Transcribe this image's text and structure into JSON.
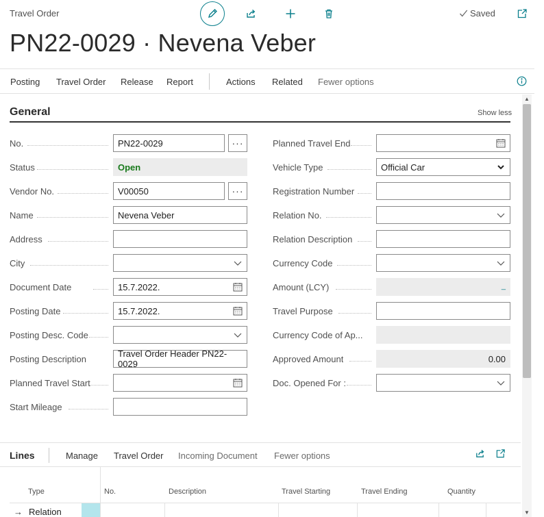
{
  "header": {
    "page_kind": "Travel Order",
    "title": "PN22-0029 · Nevena Veber",
    "saved": "Saved",
    "icons": [
      "edit-icon",
      "share-icon",
      "plus-icon",
      "trash-icon",
      "check-icon",
      "popout-icon"
    ]
  },
  "actions": {
    "items": [
      "Posting",
      "Travel Order",
      "Release",
      "Report",
      "Actions",
      "Related",
      "Fewer options"
    ]
  },
  "general": {
    "title": "General",
    "show_less": "Show less",
    "left": {
      "no": {
        "label": "No.",
        "value": "PN22-0029"
      },
      "status": {
        "label": "Status",
        "value": "Open"
      },
      "vendor_no": {
        "label": "Vendor No.",
        "value": "V00050"
      },
      "name": {
        "label": "Name",
        "value": "Nevena Veber"
      },
      "address": {
        "label": "Address",
        "value": ""
      },
      "city": {
        "label": "City",
        "value": ""
      },
      "document_date": {
        "label": "Document Date",
        "value": "15.7.2022."
      },
      "posting_date": {
        "label": "Posting Date",
        "value": "15.7.2022."
      },
      "posting_desc_code": {
        "label": "Posting Desc. Code",
        "value": ""
      },
      "posting_description": {
        "label": "Posting Description",
        "value": "Travel Order Header PN22-0029"
      },
      "planned_travel_start": {
        "label": "Planned Travel Start",
        "value": ""
      },
      "start_mileage": {
        "label": "Start Mileage",
        "value": ""
      }
    },
    "right": {
      "planned_travel_end": {
        "label": "Planned Travel End",
        "value": ""
      },
      "vehicle_type": {
        "label": "Vehicle Type",
        "value": "Official Car"
      },
      "registration_number": {
        "label": "Registration Number",
        "value": ""
      },
      "relation_no": {
        "label": "Relation No.",
        "value": ""
      },
      "relation_description": {
        "label": "Relation Description",
        "value": ""
      },
      "currency_code": {
        "label": "Currency Code",
        "value": ""
      },
      "amount_lcy": {
        "label": "Amount (LCY)",
        "value": "_"
      },
      "travel_purpose": {
        "label": "Travel Purpose",
        "value": ""
      },
      "currency_code_approved": {
        "label": "Currency Code of Ap...",
        "value": ""
      },
      "approved_amount": {
        "label": "Approved Amount",
        "value": "0.00"
      },
      "doc_opened_for": {
        "label": "Doc. Opened For :",
        "value": ""
      }
    }
  },
  "lines": {
    "title": "Lines",
    "actions": [
      "Manage",
      "Travel Order",
      "Incoming Document",
      "Fewer options"
    ],
    "columns": [
      "Type",
      "No.",
      "Description",
      "Travel Starting",
      "Travel Ending",
      "Quantity"
    ],
    "rows": [
      {
        "type": "Relation"
      }
    ]
  }
}
